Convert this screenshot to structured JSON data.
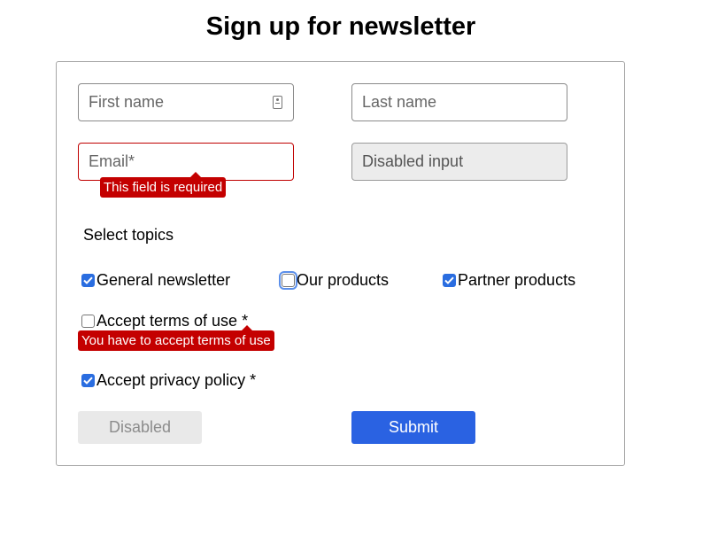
{
  "page": {
    "title": "Sign up for newsletter"
  },
  "form": {
    "first_name": {
      "placeholder": "First name",
      "icon": "contact-card-icon"
    },
    "last_name": {
      "placeholder": "Last name"
    },
    "email": {
      "placeholder": "Email*",
      "error": "This field is required",
      "state": "error"
    },
    "disabled_input": {
      "placeholder": "Disabled input",
      "state": "disabled"
    },
    "topics_label": "Select topics",
    "topics": [
      {
        "label": "General newsletter",
        "checked": true
      },
      {
        "label": "Our products",
        "checked": false,
        "focused": true
      },
      {
        "label": "Partner products",
        "checked": true
      }
    ],
    "terms": {
      "label": "Accept terms of use *",
      "checked": false,
      "error": "You have to accept terms of use"
    },
    "privacy": {
      "label": "Accept privacy policy *",
      "checked": true
    },
    "buttons": {
      "disabled_label": "Disabled",
      "submit_label": "Submit"
    }
  },
  "colors": {
    "accent": "#2a62e2",
    "error": "#c40000",
    "checkbox": "#2a6de0"
  }
}
